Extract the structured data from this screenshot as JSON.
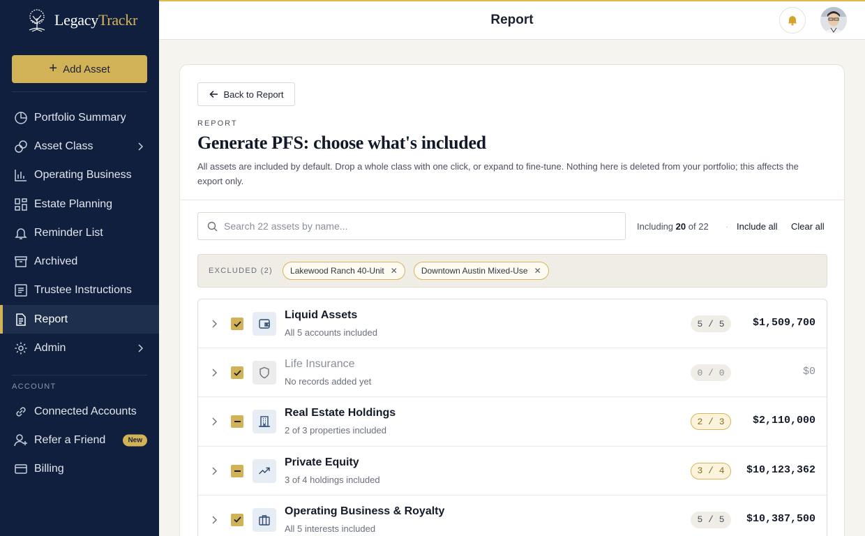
{
  "brand": {
    "name_part1": "Legacy",
    "name_part2": "Trackr",
    "accent_color": "#d2b257",
    "sidebar_color": "#0f1f3d"
  },
  "sidebar": {
    "add_asset_label": "Add Asset",
    "items": [
      {
        "label": "Portfolio Summary",
        "icon": "pie-chart-icon"
      },
      {
        "label": "Asset Class",
        "icon": "coins-icon",
        "has_submenu": true
      },
      {
        "label": "Operating Business",
        "icon": "bar-chart-icon"
      },
      {
        "label": "Estate Planning",
        "icon": "grid-icon"
      },
      {
        "label": "Reminder List",
        "icon": "bell-icon"
      },
      {
        "label": "Archived",
        "icon": "archive-icon"
      },
      {
        "label": "Trustee Instructions",
        "icon": "document-icon"
      },
      {
        "label": "Report",
        "icon": "report-icon",
        "active": true
      },
      {
        "label": "Admin",
        "icon": "gear-icon",
        "has_submenu": true
      }
    ],
    "account_section_label": "ACCOUNT",
    "account_items": [
      {
        "label": "Connected Accounts",
        "icon": "link-icon"
      },
      {
        "label": "Refer a Friend",
        "icon": "user-plus-icon",
        "badge": "New"
      },
      {
        "label": "Billing",
        "icon": "credit-card-icon"
      }
    ]
  },
  "header": {
    "title": "Report"
  },
  "page": {
    "back_label": "Back to Report",
    "eyebrow": "REPORT",
    "title": "Generate PFS: choose what's included",
    "description": "All assets are included by default. Drop a whole class with one click, or expand to fine-tune. Nothing here is deleted from your portfolio; this affects the export only."
  },
  "toolbar": {
    "search_placeholder": "Search 22 assets by name...",
    "including_prefix": "Including",
    "including_count": "20",
    "including_suffix": "of 22",
    "separator": "·",
    "include_all_label": "Include all",
    "clear_all_label": "Clear all"
  },
  "excluded": {
    "label": "EXCLUDED (2)",
    "chips": [
      "Lakewood Ranch 40-Unit",
      "Downtown Austin Mixed-Use"
    ]
  },
  "asset_classes": [
    {
      "name": "Liquid Assets",
      "sub": "All 5 accounts included",
      "count": "5 / 5",
      "amount": "$1,509,700",
      "state": "checked",
      "icon": "wallet-icon"
    },
    {
      "name": "Life Insurance",
      "sub": "No records added yet",
      "count": "0 / 0",
      "amount": "$0",
      "state": "checked",
      "icon": "shield-icon",
      "muted": true
    },
    {
      "name": "Real Estate Holdings",
      "sub": "2 of 3 properties included",
      "count": "2 / 3",
      "amount": "$2,110,000",
      "state": "partial",
      "icon": "building-icon"
    },
    {
      "name": "Private Equity",
      "sub": "3 of 4 holdings included",
      "count": "3 / 4",
      "amount": "$10,123,362",
      "state": "partial",
      "icon": "trending-up-icon"
    },
    {
      "name": "Operating Business & Royalty",
      "sub": "All 5 interests included",
      "count": "5 / 5",
      "amount": "$10,387,500",
      "state": "checked",
      "icon": "briefcase-icon"
    }
  ]
}
